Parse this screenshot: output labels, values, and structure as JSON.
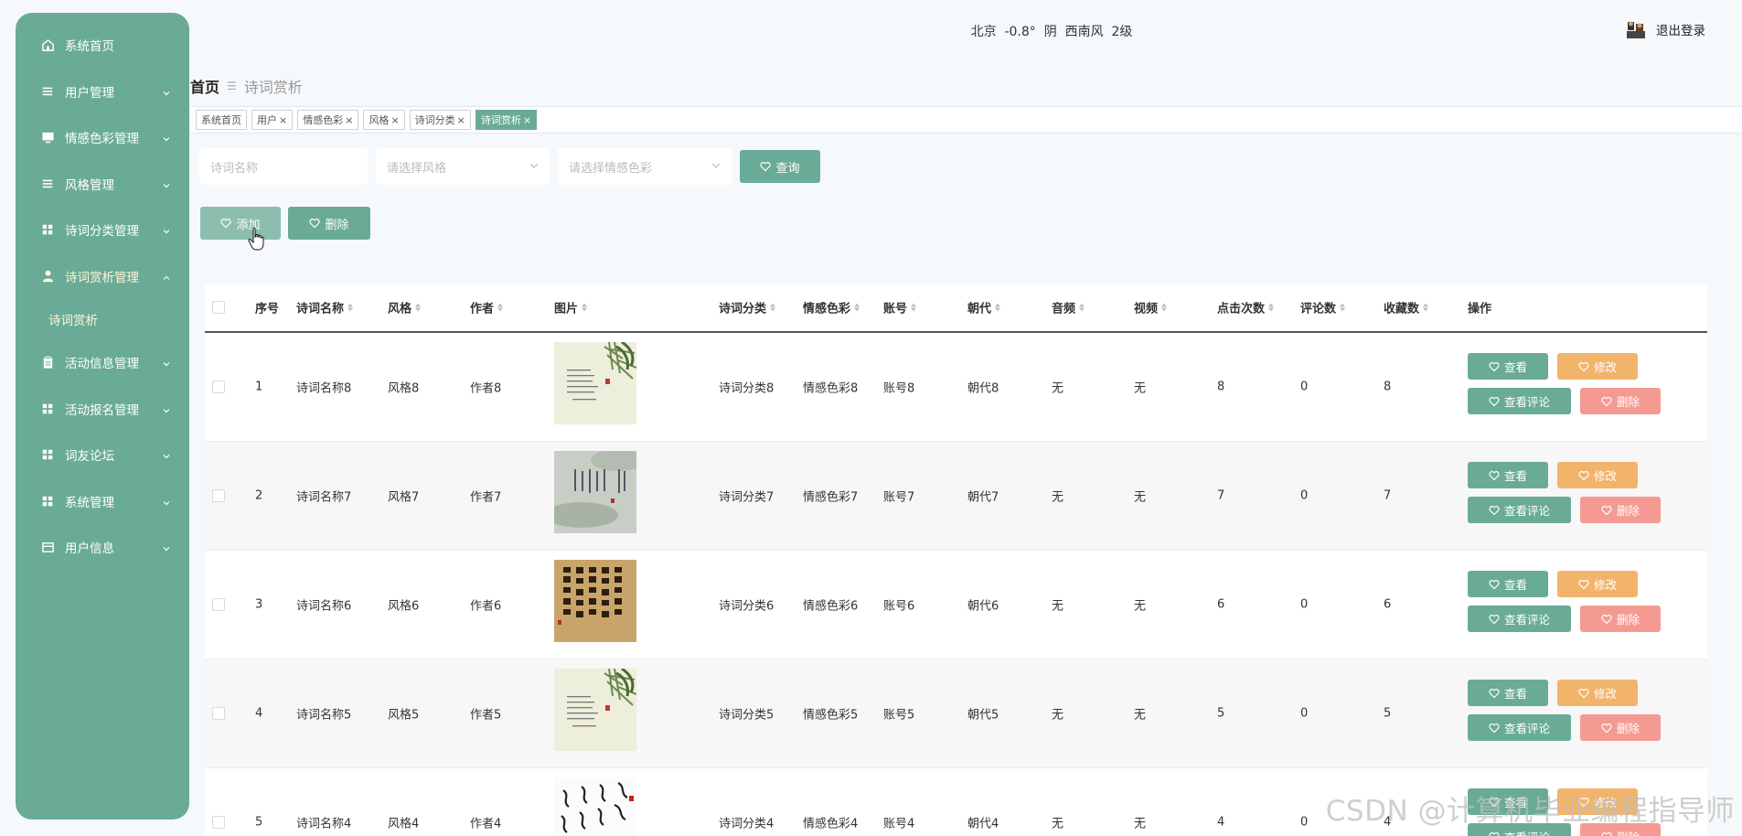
{
  "sidebar": {
    "items": [
      {
        "label": "系统首页",
        "icon": "home-icon",
        "chevron": false
      },
      {
        "label": "用户管理",
        "icon": "list-icon",
        "chevron": true
      },
      {
        "label": "情感色彩管理",
        "icon": "monitor-icon",
        "chevron": true
      },
      {
        "label": "风格管理",
        "icon": "list-icon",
        "chevron": true
      },
      {
        "label": "诗词分类管理",
        "icon": "grid-icon",
        "chevron": true
      },
      {
        "label": "诗词赏析管理",
        "icon": "user-icon",
        "chevron": true,
        "active": true
      },
      {
        "label": "活动信息管理",
        "icon": "clipboard-icon",
        "chevron": true
      },
      {
        "label": "活动报名管理",
        "icon": "grid-icon",
        "chevron": true
      },
      {
        "label": "词友论坛",
        "icon": "grid-icon",
        "chevron": true
      },
      {
        "label": "系统管理",
        "icon": "grid-icon",
        "chevron": true
      },
      {
        "label": "用户信息",
        "icon": "card-icon",
        "chevron": true
      }
    ],
    "submenu_label": "诗词赏析"
  },
  "header": {
    "weather": "北京  -0.8°  阴  西南风  2级",
    "logout": "退出登录"
  },
  "breadcrumb": {
    "home": "首页",
    "current": "诗词赏析"
  },
  "tabs": [
    {
      "label": "系统首页",
      "closable": false
    },
    {
      "label": "用户",
      "closable": true
    },
    {
      "label": "情感色彩",
      "closable": true
    },
    {
      "label": "风格",
      "closable": true
    },
    {
      "label": "诗词分类",
      "closable": true
    },
    {
      "label": "诗词赏析",
      "closable": true,
      "active": true
    }
  ],
  "search": {
    "name_placeholder": "诗词名称",
    "style_placeholder": "请选择风格",
    "emotion_placeholder": "请选择情感色彩",
    "query_label": "查询"
  },
  "actions": {
    "add_label": "添加",
    "delete_label": "删除"
  },
  "table": {
    "headers": [
      "序号",
      "诗词名称",
      "风格",
      "作者",
      "图片",
      "诗词分类",
      "情感色彩",
      "账号",
      "朝代",
      "音频",
      "视频",
      "点击次数",
      "评论数",
      "收藏数",
      "操作"
    ],
    "rows": [
      {
        "idx": "1",
        "name": "诗词名称8",
        "style": "风格8",
        "author": "作者8",
        "category": "诗词分类8",
        "emotion": "情感色彩8",
        "account": "账号8",
        "dynasty": "朝代8",
        "audio": "无",
        "video": "无",
        "clicks": "8",
        "comments": "0",
        "favorites": "8",
        "thumb": "bamboo"
      },
      {
        "idx": "2",
        "name": "诗词名称7",
        "style": "风格7",
        "author": "作者7",
        "category": "诗词分类7",
        "emotion": "情感色彩7",
        "account": "账号7",
        "dynasty": "朝代7",
        "audio": "无",
        "video": "无",
        "clicks": "7",
        "comments": "0",
        "favorites": "7",
        "thumb": "mist"
      },
      {
        "idx": "3",
        "name": "诗词名称6",
        "style": "风格6",
        "author": "作者6",
        "category": "诗词分类6",
        "emotion": "情感色彩6",
        "account": "账号6",
        "dynasty": "朝代6",
        "audio": "无",
        "video": "无",
        "clicks": "6",
        "comments": "0",
        "favorites": "6",
        "thumb": "calligraphy"
      },
      {
        "idx": "4",
        "name": "诗词名称5",
        "style": "风格5",
        "author": "作者5",
        "category": "诗词分类5",
        "emotion": "情感色彩5",
        "account": "账号5",
        "dynasty": "朝代5",
        "audio": "无",
        "video": "无",
        "clicks": "5",
        "comments": "0",
        "favorites": "5",
        "thumb": "bamboo"
      },
      {
        "idx": "5",
        "name": "诗词名称4",
        "style": "风格4",
        "author": "作者4",
        "category": "诗词分类4",
        "emotion": "情感色彩4",
        "account": "账号4",
        "dynasty": "朝代4",
        "audio": "无",
        "video": "无",
        "clicks": "4",
        "comments": "0",
        "favorites": "4",
        "thumb": "cursive"
      }
    ],
    "op_view": "查看",
    "op_edit": "修改",
    "op_view_comments": "查看评论",
    "op_delete": "删除"
  },
  "watermark": "CSDN @计算机毕业编程指导师",
  "colors": {
    "primary": "#6aab98",
    "orange": "#f2b46b",
    "pink": "#f59a93",
    "light": "#8dbdaf"
  }
}
